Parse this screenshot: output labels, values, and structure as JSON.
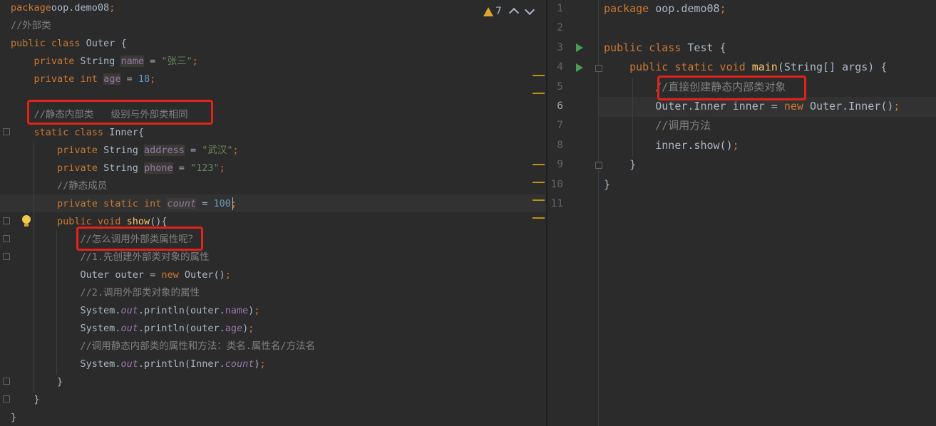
{
  "left_editor": {
    "inspection": {
      "warning_count": "7"
    },
    "lines": [
      [
        [
          "kw",
          "package"
        ],
        [
          "",
          "oop.demo08"
        ],
        [
          "kw",
          ";"
        ]
      ],
      [
        [
          "cmt",
          "//外部类"
        ]
      ],
      [
        [
          "kw",
          "public class "
        ],
        [
          "",
          "Outer {"
        ]
      ],
      [
        [
          "",
          "    "
        ],
        [
          "kw",
          "private "
        ],
        [
          "",
          "String "
        ],
        [
          "fld hl",
          "name"
        ],
        [
          "",
          " = "
        ],
        [
          "str",
          "\"张三\""
        ],
        [
          "kw",
          ";"
        ]
      ],
      [
        [
          "",
          "    "
        ],
        [
          "kw",
          "private int "
        ],
        [
          "fld hl",
          "age"
        ],
        [
          "",
          " = "
        ],
        [
          "num",
          "18"
        ],
        [
          "kw",
          ";"
        ]
      ],
      [
        [
          "",
          ""
        ]
      ],
      [
        [
          "",
          "    "
        ],
        [
          "cmt",
          "//静态内部类   级别与外部类相同"
        ]
      ],
      [
        [
          "",
          "    "
        ],
        [
          "kw",
          "static class "
        ],
        [
          "",
          "Inner{"
        ]
      ],
      [
        [
          "",
          "        "
        ],
        [
          "kw",
          "private "
        ],
        [
          "",
          "String "
        ],
        [
          "fld hl",
          "address"
        ],
        [
          "",
          " = "
        ],
        [
          "str",
          "\"武汉\""
        ],
        [
          "kw",
          ";"
        ]
      ],
      [
        [
          "",
          "        "
        ],
        [
          "kw",
          "private "
        ],
        [
          "",
          "String "
        ],
        [
          "fld hl",
          "phone"
        ],
        [
          "",
          " = "
        ],
        [
          "str",
          "\"123\""
        ],
        [
          "kw",
          ";"
        ]
      ],
      [
        [
          "",
          "        "
        ],
        [
          "cmt",
          "//静态成员"
        ]
      ],
      [
        [
          "",
          "        "
        ],
        [
          "kw",
          "private static int "
        ],
        [
          "ital hl",
          "count"
        ],
        [
          "",
          " = "
        ],
        [
          "num",
          "100"
        ],
        [
          "kw",
          ";"
        ]
      ],
      [
        [
          "",
          "        "
        ],
        [
          "kw",
          "public void "
        ],
        [
          "fn",
          "show"
        ],
        [
          "",
          "(){"
        ]
      ],
      [
        [
          "",
          "            "
        ],
        [
          "cmt",
          "//怎么调用外部类属性呢？"
        ]
      ],
      [
        [
          "",
          "            "
        ],
        [
          "cmt",
          "//1.先创建外部类对象的属性"
        ]
      ],
      [
        [
          "",
          "            "
        ],
        [
          "",
          "Outer outer = "
        ],
        [
          "kw",
          "new "
        ],
        [
          "",
          "Outer()"
        ],
        [
          "kw",
          ";"
        ]
      ],
      [
        [
          "",
          "            "
        ],
        [
          "cmt",
          "//2.调用外部类对象的属性"
        ]
      ],
      [
        [
          "",
          "            "
        ],
        [
          "",
          "System."
        ],
        [
          "ital",
          "out"
        ],
        [
          "",
          ".println(outer."
        ],
        [
          "fld",
          "name"
        ],
        [
          "",
          ")"
        ],
        [
          "kw",
          ";"
        ]
      ],
      [
        [
          "",
          "            "
        ],
        [
          "",
          "System."
        ],
        [
          "ital",
          "out"
        ],
        [
          "",
          ".println(outer."
        ],
        [
          "fld",
          "age"
        ],
        [
          "",
          ")"
        ],
        [
          "kw",
          ";"
        ]
      ],
      [
        [
          "",
          "            "
        ],
        [
          "cmt",
          "//调用静态内部类的属性和方法：类名.属性名/方法名"
        ]
      ],
      [
        [
          "",
          "            "
        ],
        [
          "",
          "System."
        ],
        [
          "ital",
          "out"
        ],
        [
          "",
          ".println(Inner."
        ],
        [
          "ital",
          "count"
        ],
        [
          "",
          ")"
        ],
        [
          "kw",
          ";"
        ]
      ],
      [
        [
          "",
          "        "
        ],
        [
          "",
          "}"
        ]
      ],
      [
        [
          "",
          "    "
        ],
        [
          "",
          "}"
        ]
      ],
      [
        [
          "",
          "}"
        ]
      ]
    ]
  },
  "right_editor": {
    "line_numbers": [
      "1",
      "2",
      "3",
      "4",
      "5",
      "6",
      "7",
      "8",
      "9",
      "10",
      "11"
    ],
    "lines": [
      [
        [
          "kw",
          "package "
        ],
        [
          "",
          "oop.demo08"
        ],
        [
          "kw",
          ";"
        ]
      ],
      [
        [
          "",
          ""
        ]
      ],
      [
        [
          "kw",
          "public class "
        ],
        [
          "",
          "Test {"
        ]
      ],
      [
        [
          "",
          "    "
        ],
        [
          "kw",
          "public static void "
        ],
        [
          "fn",
          "main"
        ],
        [
          "",
          "(String[] args) {"
        ]
      ],
      [
        [
          "",
          "        "
        ],
        [
          "cmt",
          "//直接创建静态内部类对象"
        ]
      ],
      [
        [
          "",
          "        "
        ],
        [
          "",
          "Outer.Inner inner = "
        ],
        [
          "kw",
          "new "
        ],
        [
          "",
          "Outer.Inner()"
        ],
        [
          "kw",
          ";"
        ]
      ],
      [
        [
          "",
          "        "
        ],
        [
          "cmt",
          "//调用方法"
        ]
      ],
      [
        [
          "",
          "        "
        ],
        [
          "",
          "inner.show()"
        ],
        [
          "kw",
          ";"
        ]
      ],
      [
        [
          "",
          "    "
        ],
        [
          "",
          "}"
        ]
      ],
      [
        [
          "",
          "}"
        ]
      ],
      [
        [
          "",
          ""
        ]
      ]
    ]
  },
  "colors": {
    "keyword": "#cc7832",
    "string": "#6a8759",
    "number": "#6897bb",
    "comment": "#808080",
    "field": "#9876aa",
    "method": "#ffc66d",
    "annotation_box": "#e3221b"
  }
}
